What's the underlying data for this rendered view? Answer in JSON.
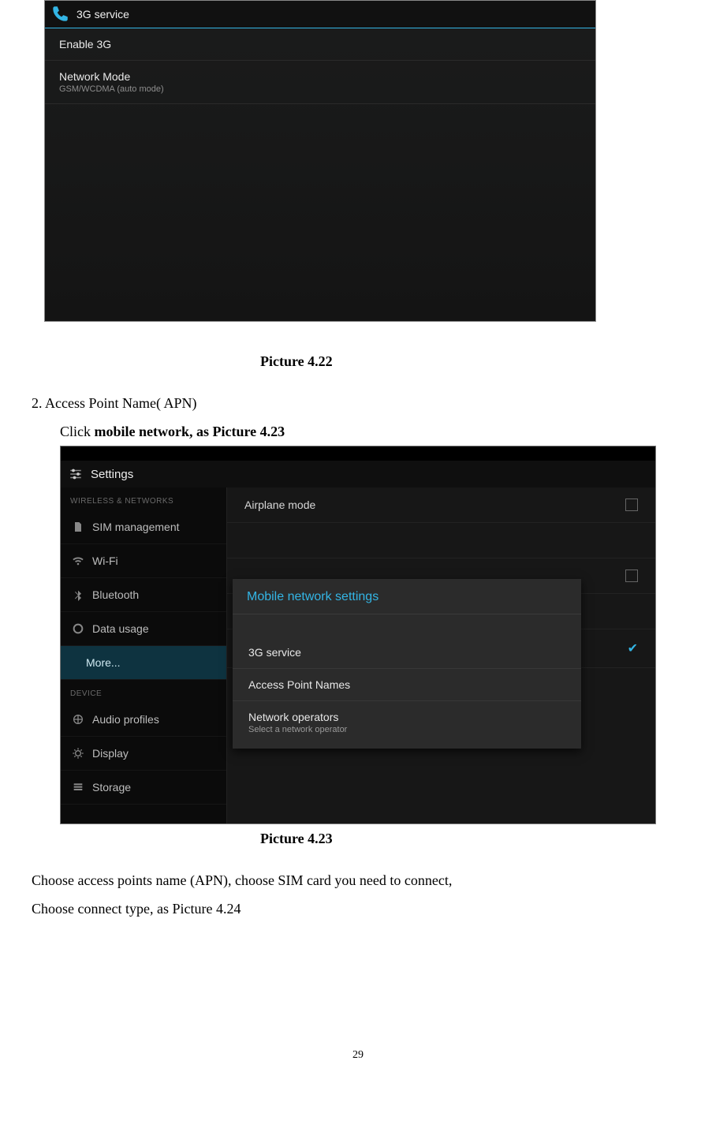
{
  "screenshot1": {
    "title": "3G service",
    "rows": [
      {
        "primary": "Enable 3G",
        "secondary": ""
      },
      {
        "primary": "Network Mode",
        "secondary": "GSM/WCDMA (auto mode)"
      }
    ]
  },
  "captions": {
    "c1": "Picture 4.22",
    "c2": "Picture 4.23"
  },
  "text": {
    "num2": "2.    Access Point Name( APN)",
    "click_prefix": " Click ",
    "click_bold": "mobile network, as Picture 4.23",
    "choose1": "Choose access points name (APN), choose SIM card you need to connect,",
    "choose2": "Choose connect type, as Picture 4.24"
  },
  "screenshot2": {
    "header": "Settings",
    "sections": {
      "wireless": "WIRELESS & NETWORKS",
      "device": "DEVICE"
    },
    "sidebar": [
      {
        "label": "SIM management",
        "icon": "sim"
      },
      {
        "label": "Wi-Fi",
        "icon": "wifi"
      },
      {
        "label": "Bluetooth",
        "icon": "bt"
      },
      {
        "label": "Data usage",
        "icon": "data"
      },
      {
        "label": "More...",
        "icon": "",
        "active": true
      },
      {
        "section": "device"
      },
      {
        "label": "Audio profiles",
        "icon": "audio"
      },
      {
        "label": "Display",
        "icon": "display"
      },
      {
        "label": "Storage",
        "icon": "storage"
      }
    ],
    "content": {
      "row1": "Airplane mode",
      "row4_checked": true
    },
    "dialog": {
      "title": "Mobile network settings",
      "items": [
        {
          "primary": "3G service"
        },
        {
          "primary": "Access Point Names"
        },
        {
          "primary": "Network operators",
          "secondary": "Select a network operator"
        }
      ]
    }
  },
  "page_number": "29"
}
